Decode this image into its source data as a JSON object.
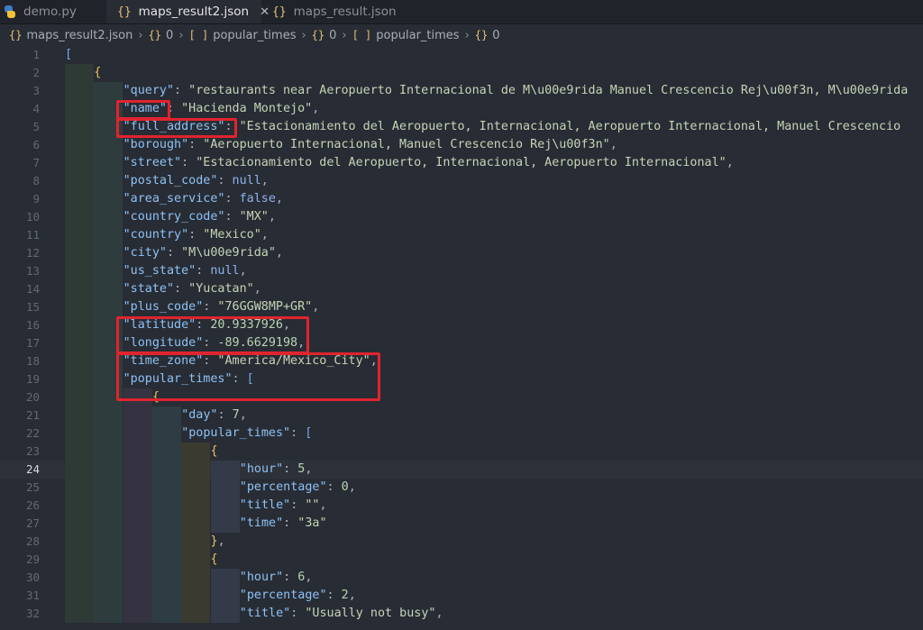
{
  "tabs": [
    {
      "label": "demo.py",
      "icon": "python-icon"
    },
    {
      "label": "maps_result2.json",
      "icon": "json-braces-icon",
      "active": true
    },
    {
      "label": "maps_result.json",
      "icon": "json-braces-icon"
    }
  ],
  "tab_close_glyph": "✕",
  "breadcrumb": {
    "file": "maps_result2.json",
    "segments": [
      {
        "icon": "{}",
        "label": "0"
      },
      {
        "icon": "[ ]",
        "label": "popular_times"
      },
      {
        "icon": "{}",
        "label": "0"
      },
      {
        "icon": "[ ]",
        "label": "popular_times"
      },
      {
        "icon": "{}",
        "label": "0"
      }
    ]
  },
  "editor": {
    "current_line": 24,
    "lines": [
      {
        "n": "1",
        "indent": 0,
        "code": [
          [
            "br1",
            "["
          ]
        ]
      },
      {
        "n": "2",
        "indent": 1,
        "code": [
          [
            "curly",
            "{"
          ]
        ]
      },
      {
        "n": "3",
        "indent": 2,
        "code": [
          [
            "k",
            "\"query\""
          ],
          [
            "p",
            ": "
          ],
          [
            "s",
            "\"restaurants near Aeropuerto Internacional de M\\u00e9rida Manuel Crescencio Rej\\u00f3n, M\\u00e9rida"
          ]
        ]
      },
      {
        "n": "4",
        "indent": 2,
        "code": [
          [
            "k",
            "\"name\""
          ],
          [
            "p",
            ": "
          ],
          [
            "s",
            "\"Hacienda Montejo\""
          ],
          [
            "p",
            ","
          ]
        ]
      },
      {
        "n": "5",
        "indent": 2,
        "code": [
          [
            "k",
            "\"full_address\""
          ],
          [
            "p",
            ": "
          ],
          [
            "s",
            "\"Estacionamiento del Aeropuerto, Internacional, Aeropuerto Internacional, Manuel Crescencio"
          ]
        ]
      },
      {
        "n": "6",
        "indent": 2,
        "code": [
          [
            "k",
            "\"borough\""
          ],
          [
            "p",
            ": "
          ],
          [
            "s",
            "\"Aeropuerto Internacional, Manuel Crescencio Rej\\u00f3n\""
          ],
          [
            "p",
            ","
          ]
        ]
      },
      {
        "n": "7",
        "indent": 2,
        "code": [
          [
            "k",
            "\"street\""
          ],
          [
            "p",
            ": "
          ],
          [
            "s",
            "\"Estacionamiento del Aeropuerto, Internacional, Aeropuerto Internacional\""
          ],
          [
            "p",
            ","
          ]
        ]
      },
      {
        "n": "8",
        "indent": 2,
        "code": [
          [
            "k",
            "\"postal_code\""
          ],
          [
            "p",
            ": "
          ],
          [
            "kw",
            "null"
          ],
          [
            "p",
            ","
          ]
        ]
      },
      {
        "n": "9",
        "indent": 2,
        "code": [
          [
            "k",
            "\"area_service\""
          ],
          [
            "p",
            ": "
          ],
          [
            "kw",
            "false"
          ],
          [
            "p",
            ","
          ]
        ]
      },
      {
        "n": "10",
        "indent": 2,
        "code": [
          [
            "k",
            "\"country_code\""
          ],
          [
            "p",
            ": "
          ],
          [
            "s",
            "\"MX\""
          ],
          [
            "p",
            ","
          ]
        ]
      },
      {
        "n": "11",
        "indent": 2,
        "code": [
          [
            "k",
            "\"country\""
          ],
          [
            "p",
            ": "
          ],
          [
            "s",
            "\"Mexico\""
          ],
          [
            "p",
            ","
          ]
        ]
      },
      {
        "n": "12",
        "indent": 2,
        "code": [
          [
            "k",
            "\"city\""
          ],
          [
            "p",
            ": "
          ],
          [
            "s",
            "\"M\\u00e9rida\""
          ],
          [
            "p",
            ","
          ]
        ]
      },
      {
        "n": "13",
        "indent": 2,
        "code": [
          [
            "k",
            "\"us_state\""
          ],
          [
            "p",
            ": "
          ],
          [
            "kw",
            "null"
          ],
          [
            "p",
            ","
          ]
        ]
      },
      {
        "n": "14",
        "indent": 2,
        "code": [
          [
            "k",
            "\"state\""
          ],
          [
            "p",
            ": "
          ],
          [
            "s",
            "\"Yucatan\""
          ],
          [
            "p",
            ","
          ]
        ]
      },
      {
        "n": "15",
        "indent": 2,
        "code": [
          [
            "k",
            "\"plus_code\""
          ],
          [
            "p",
            ": "
          ],
          [
            "s",
            "\"76GGW8MP+GR\""
          ],
          [
            "p",
            ","
          ]
        ]
      },
      {
        "n": "16",
        "indent": 2,
        "code": [
          [
            "k",
            "\"latitude\""
          ],
          [
            "p",
            ": "
          ],
          [
            "n",
            "20.9337926"
          ],
          [
            "p",
            ","
          ]
        ]
      },
      {
        "n": "17",
        "indent": 2,
        "code": [
          [
            "k",
            "\"longitude\""
          ],
          [
            "p",
            ": "
          ],
          [
            "n",
            "-89.6629198"
          ],
          [
            "p",
            ","
          ]
        ]
      },
      {
        "n": "18",
        "indent": 2,
        "code": [
          [
            "k",
            "\"time_zone\""
          ],
          [
            "p",
            ": "
          ],
          [
            "s",
            "\"America/Mexico_City\""
          ],
          [
            "p",
            ","
          ]
        ]
      },
      {
        "n": "19",
        "indent": 2,
        "code": [
          [
            "k",
            "\"popular_times\""
          ],
          [
            "p",
            ": "
          ],
          [
            "br1",
            "["
          ]
        ]
      },
      {
        "n": "20",
        "indent": 3,
        "code": [
          [
            "curly",
            "{"
          ]
        ]
      },
      {
        "n": "21",
        "indent": 4,
        "code": [
          [
            "k",
            "\"day\""
          ],
          [
            "p",
            ": "
          ],
          [
            "n",
            "7"
          ],
          [
            "p",
            ","
          ]
        ]
      },
      {
        "n": "22",
        "indent": 4,
        "code": [
          [
            "k",
            "\"popular_times\""
          ],
          [
            "p",
            ": "
          ],
          [
            "br1",
            "["
          ]
        ]
      },
      {
        "n": "23",
        "indent": 5,
        "code": [
          [
            "curly",
            "{"
          ]
        ]
      },
      {
        "n": "24",
        "indent": 6,
        "code": [
          [
            "k",
            "\"hour\""
          ],
          [
            "p",
            ": "
          ],
          [
            "n",
            "5"
          ],
          [
            "p",
            ","
          ]
        ]
      },
      {
        "n": "25",
        "indent": 6,
        "code": [
          [
            "k",
            "\"percentage\""
          ],
          [
            "p",
            ": "
          ],
          [
            "n",
            "0"
          ],
          [
            "p",
            ","
          ]
        ]
      },
      {
        "n": "26",
        "indent": 6,
        "code": [
          [
            "k",
            "\"title\""
          ],
          [
            "p",
            ": "
          ],
          [
            "s",
            "\"\""
          ],
          [
            "p",
            ","
          ]
        ]
      },
      {
        "n": "27",
        "indent": 6,
        "code": [
          [
            "k",
            "\"time\""
          ],
          [
            "p",
            ": "
          ],
          [
            "s",
            "\"3a\""
          ]
        ]
      },
      {
        "n": "28",
        "indent": 5,
        "code": [
          [
            "curly",
            "}"
          ],
          [
            "p",
            ","
          ]
        ]
      },
      {
        "n": "29",
        "indent": 5,
        "code": [
          [
            "curly",
            "{"
          ]
        ]
      },
      {
        "n": "30",
        "indent": 6,
        "code": [
          [
            "k",
            "\"hour\""
          ],
          [
            "p",
            ": "
          ],
          [
            "n",
            "6"
          ],
          [
            "p",
            ","
          ]
        ]
      },
      {
        "n": "31",
        "indent": 6,
        "code": [
          [
            "k",
            "\"percentage\""
          ],
          [
            "p",
            ": "
          ],
          [
            "n",
            "2"
          ],
          [
            "p",
            ","
          ]
        ]
      },
      {
        "n": "32",
        "indent": 6,
        "code": [
          [
            "k",
            "\"title\""
          ],
          [
            "p",
            ": "
          ],
          [
            "s",
            "\"Usually not busy\""
          ],
          [
            "p",
            ","
          ]
        ]
      }
    ]
  },
  "highlight_color": "#e0242e"
}
